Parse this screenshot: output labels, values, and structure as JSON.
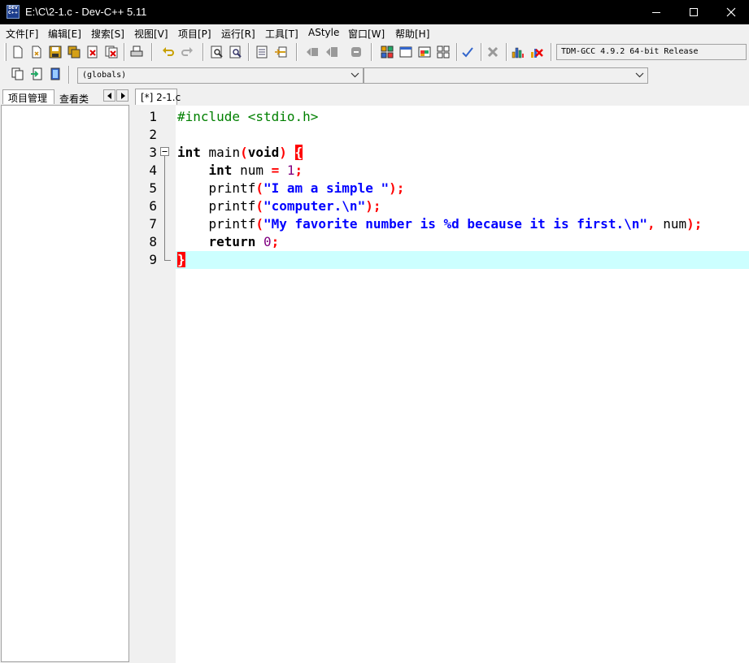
{
  "window": {
    "title": "E:\\C\\2-1.c - Dev-C++ 5.11",
    "icon_text": "DEV C++"
  },
  "menu": {
    "file": "文件[F]",
    "edit": "编辑[E]",
    "search": "搜索[S]",
    "view": "视图[V]",
    "project": "项目[P]",
    "run": "运行[R]",
    "tools": "工具[T]",
    "astyle": "AStyle",
    "window": "窗口[W]",
    "help": "帮助[H]"
  },
  "toolbar": {
    "compiler": "TDM-GCC 4.9.2 64-bit Release",
    "scope": "(globals)",
    "function": ""
  },
  "left_panel": {
    "tab_project": "项目管理",
    "tab_classes": "查看类"
  },
  "editor": {
    "tab_label": "[*] 2-1.c",
    "line_numbers": [
      "1",
      "2",
      "3",
      "4",
      "5",
      "6",
      "7",
      "8",
      "9"
    ],
    "code": {
      "l1": "#include <stdio.h>",
      "l3_kw": "int",
      "l3_fn": " main",
      "l3_open": "(",
      "l3_void": "void",
      "l3_close": ")",
      "l3_brace": "{",
      "l4_kw": "int",
      "l4_var": " num ",
      "l4_eq": "=",
      "l4_num": "1",
      "l4_semi": ";",
      "l5_fn": "printf",
      "l5_open": "(",
      "l5_str": "\"I am a simple \"",
      "l5_end": ");",
      "l6_fn": "printf",
      "l6_open": "(",
      "l6_str": "\"computer.\\n\"",
      "l6_end": ");",
      "l7_fn": "printf",
      "l7_open": "(",
      "l7_str": "\"My favorite number is %d because it is first.\\n\"",
      "l7_comma": ",",
      "l7_arg": " num",
      "l7_end": ");",
      "l8_kw": "return",
      "l8_num": "0",
      "l8_semi": ";",
      "l9_brace": "}"
    }
  },
  "colors": {
    "preprocessor": "#008000",
    "keyword": "#000000",
    "symbol": "#ff0000",
    "string": "#0000ff",
    "number": "#800080",
    "current_line": "#ccffff",
    "brace_highlight": "#ff0000"
  }
}
